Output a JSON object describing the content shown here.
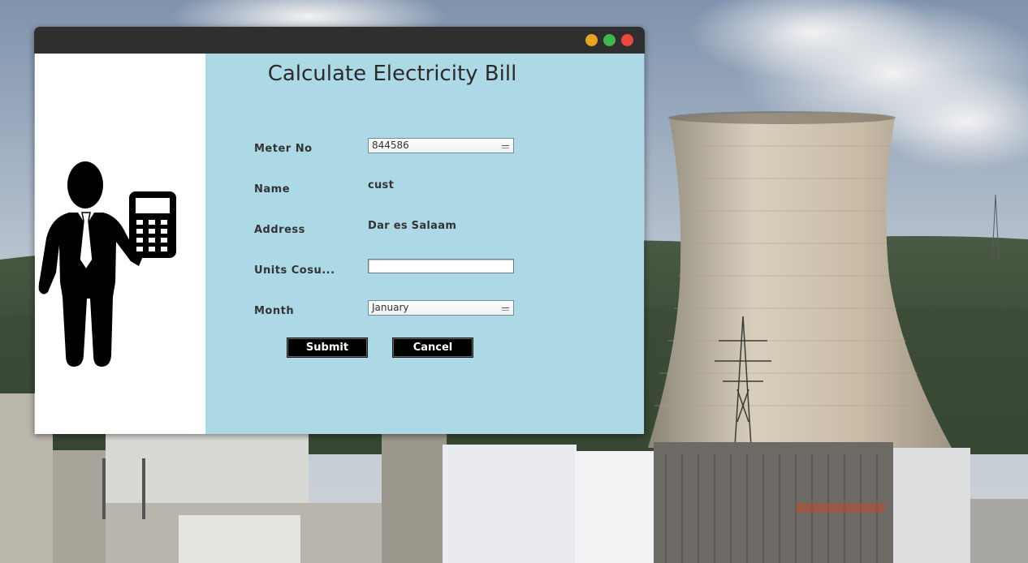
{
  "window": {
    "title": "",
    "controls": [
      "minimize-button",
      "maximize-button",
      "close-button"
    ]
  },
  "form": {
    "heading": "Calculate Electricity Bill",
    "fields": {
      "meter_no": {
        "label": "Meter No",
        "value": "844586"
      },
      "name": {
        "label": "Name",
        "value": "cust"
      },
      "address": {
        "label": "Address",
        "value": "Dar es Salaam"
      },
      "units": {
        "label": "Units Cosu...",
        "value": ""
      },
      "month": {
        "label": "Month",
        "value": "January"
      }
    },
    "buttons": {
      "submit": "Submit",
      "cancel": "Cancel"
    }
  },
  "illustration": {
    "icon": "businessman-with-calculator-icon"
  },
  "colors": {
    "form_background": "#add8e6",
    "titlebar": "#2f2f2f",
    "button_background": "#000000",
    "button_text": "#ffffff",
    "minimize": "#e8a522",
    "maximize": "#40b84d",
    "close": "#e84840"
  }
}
